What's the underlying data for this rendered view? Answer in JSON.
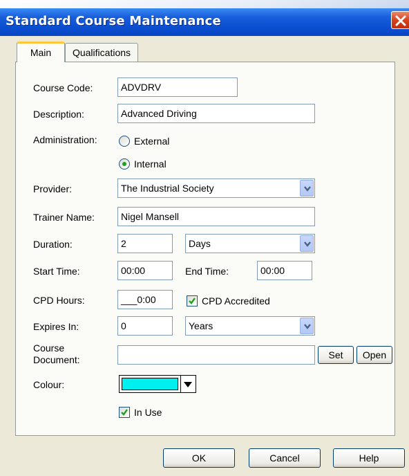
{
  "window": {
    "title": "Standard Course Maintenance"
  },
  "tabs": [
    {
      "label": "Main",
      "active": true
    },
    {
      "label": "Qualifications",
      "active": false
    }
  ],
  "form": {
    "course_code_label": "Course Code:",
    "course_code_value": "ADVDRV",
    "description_label": "Description:",
    "description_value": "Advanced Driving",
    "administration_label": "Administration:",
    "admin_options": [
      {
        "label": "External",
        "selected": false
      },
      {
        "label": "Internal",
        "selected": true
      }
    ],
    "provider_label": "Provider:",
    "provider_value": "The Industrial Society",
    "trainer_label": "Trainer Name:",
    "trainer_value": "Nigel Mansell",
    "duration_label": "Duration:",
    "duration_value": "2",
    "duration_unit": "Days",
    "start_time_label": "Start Time:",
    "start_time_value": "00:00",
    "end_time_label": "End Time:",
    "end_time_value": "00:00",
    "cpd_hours_label": "CPD Hours:",
    "cpd_hours_value": "___0:00",
    "cpd_accredited_label": "CPD Accredited",
    "cpd_accredited_checked": true,
    "expires_label": "Expires In:",
    "expires_value": "0",
    "expires_unit": "Years",
    "course_doc_label_line1": "Course",
    "course_doc_label_line2": "Document:",
    "course_doc_value": "",
    "set_label": "Set",
    "open_label": "Open",
    "colour_label": "Colour:",
    "colour_value": "#00f0f0",
    "in_use_label": "In Use",
    "in_use_checked": true
  },
  "footer": {
    "ok_label": "OK",
    "cancel_label": "Cancel",
    "help_label": "Help"
  },
  "icons": {
    "close": "close-icon",
    "dropdown": "chevron-down-icon",
    "check": "check-icon"
  }
}
